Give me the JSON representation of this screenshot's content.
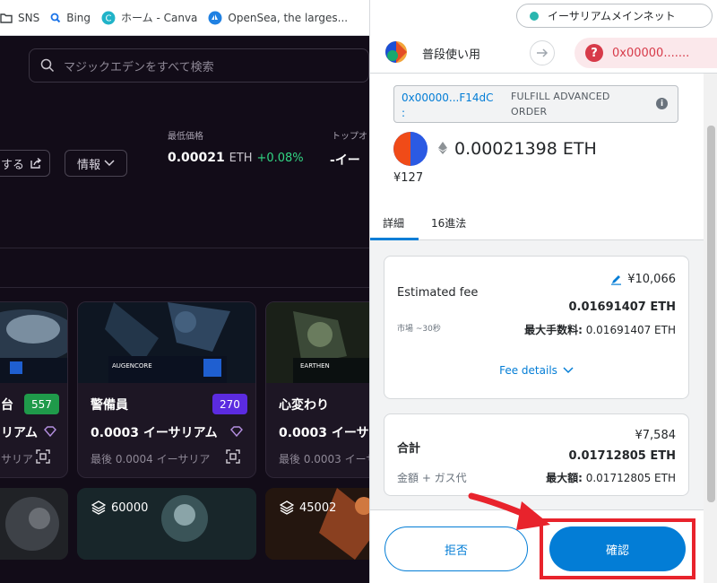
{
  "bookmarks": [
    {
      "label": "SNS",
      "icon": "folder-icon"
    },
    {
      "label": "Bing",
      "icon": "search-icon"
    },
    {
      "label": "ホーム - Canva",
      "icon": "canva-icon"
    },
    {
      "label": "OpenSea, the larges...",
      "icon": "opensea-icon"
    }
  ],
  "marketplace": {
    "search_placeholder": "マジックエデンをすべて検索",
    "share_label": "する",
    "info_label": "情報",
    "floor_price_label": "最低価格",
    "floor_price_value": "0.00021",
    "floor_price_unit": "ETH",
    "floor_price_change": "+0.08%",
    "top_offer_label": "トップオ",
    "top_offer_value": "-イー",
    "cards": [
      {
        "name": "台",
        "badge": "557",
        "badge_color": "#1f9a4a",
        "price": "リアム",
        "last": "サリア",
        "art_text": ""
      },
      {
        "name": "警備員",
        "badge": "270",
        "badge_color": "#5b2be0",
        "price": "0.0003 イーサリアム",
        "last": "最後 0.0004 イーサリア",
        "art_text": "AUGENCORE"
      },
      {
        "name": "心変わり",
        "badge": "",
        "badge_color": "",
        "price": "0.0003 イーサ",
        "last": "最後 0.0003 イーサ",
        "art_text": "EARTHEN"
      }
    ],
    "bottom_cards": [
      {
        "count": ""
      },
      {
        "count": "60000"
      },
      {
        "count": "45002"
      }
    ]
  },
  "metamask": {
    "network": "イーサリアムメインネット",
    "account_name": "普段使い用",
    "recipient": "0x00000.......",
    "contract_address": "0x00000...F14dC",
    "contract_address_tail": ":",
    "contract_method": "FULFILL ADVANCED ORDER",
    "tx_amount": "0.00021398 ETH",
    "tx_fiat": "¥127",
    "tabs": [
      "詳細",
      "16進法"
    ],
    "fee": {
      "label": "Estimated fee",
      "fiat": "¥10,066",
      "eth": "0.01691407 ETH",
      "timing": "市場 ~30秒",
      "max_label": "最大手数料:",
      "max_value": "0.01691407 ETH",
      "details_link": "Fee details"
    },
    "total": {
      "label": "合計",
      "sublabel": "金額 + ガス代",
      "fiat": "¥7,584",
      "eth": "0.01712805 ETH",
      "max_label": "最大額:",
      "max_value": "0.01712805 ETH"
    },
    "reject_label": "拒否",
    "confirm_label": "確認"
  }
}
